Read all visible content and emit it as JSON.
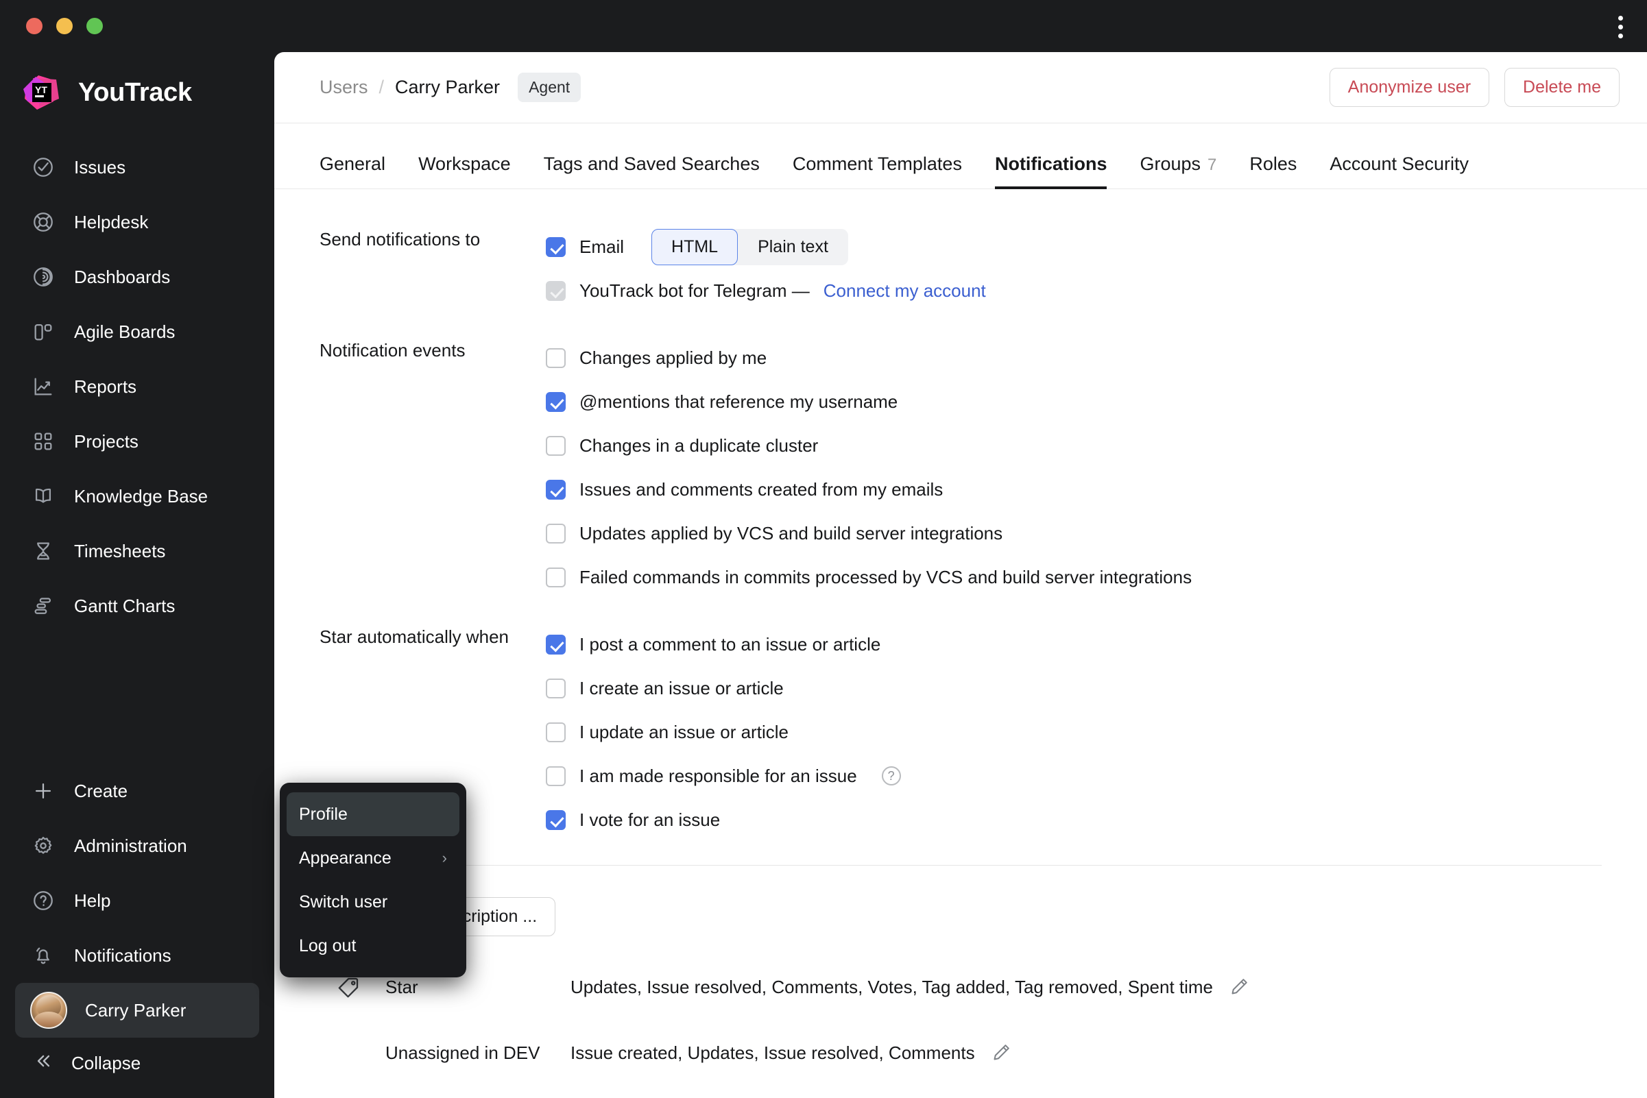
{
  "window": {
    "traffic_lights": [
      "close",
      "minimize",
      "zoom"
    ],
    "kebab_label": "more-options"
  },
  "brand": {
    "name": "YouTrack",
    "logo_text": "YT"
  },
  "sidebar": {
    "items": [
      {
        "label": "Issues",
        "icon": "check-circle-icon"
      },
      {
        "label": "Helpdesk",
        "icon": "lifebuoy-icon"
      },
      {
        "label": "Dashboards",
        "icon": "radar-icon"
      },
      {
        "label": "Agile Boards",
        "icon": "board-columns-icon"
      },
      {
        "label": "Reports",
        "icon": "chart-line-icon"
      },
      {
        "label": "Projects",
        "icon": "grid-squares-icon"
      },
      {
        "label": "Knowledge Base",
        "icon": "open-book-icon"
      },
      {
        "label": "Timesheets",
        "icon": "hourglass-icon"
      },
      {
        "label": "Gantt Charts",
        "icon": "gantt-bars-icon"
      }
    ],
    "bottom_items": [
      {
        "label": "Create",
        "icon": "plus-icon"
      },
      {
        "label": "Administration",
        "icon": "gear-icon"
      },
      {
        "label": "Help",
        "icon": "question-circle-icon"
      },
      {
        "label": "Notifications",
        "icon": "bell-icon"
      }
    ],
    "user": {
      "label": "Carry Parker",
      "icon": "avatar"
    },
    "collapse": {
      "label": "Collapse",
      "icon": "chevron-double-left-icon"
    }
  },
  "context_menu": {
    "items": [
      {
        "label": "Profile",
        "active": true,
        "submenu": false
      },
      {
        "label": "Appearance",
        "active": false,
        "submenu": true
      },
      {
        "label": "Switch user",
        "active": false,
        "submenu": false
      },
      {
        "label": "Log out",
        "active": false,
        "submenu": false
      }
    ],
    "submenu_arrow": "›"
  },
  "header": {
    "breadcrumb_parent": "Users",
    "breadcrumb_separator": "/",
    "breadcrumb_current": "Carry Parker",
    "badge": "Agent",
    "anonymize_label": "Anonymize user",
    "delete_label": "Delete me"
  },
  "tabs": [
    {
      "label": "General",
      "active": false
    },
    {
      "label": "Workspace",
      "active": false
    },
    {
      "label": "Tags and Saved Searches",
      "active": false
    },
    {
      "label": "Comment Templates",
      "active": false
    },
    {
      "label": "Notifications",
      "active": true
    },
    {
      "label": "Groups",
      "active": false,
      "count": "7"
    },
    {
      "label": "Roles",
      "active": false
    },
    {
      "label": "Account Security",
      "active": false
    }
  ],
  "send_notifications": {
    "label": "Send notifications to",
    "email": {
      "label": "Email",
      "checked": true
    },
    "format_options": [
      {
        "label": "HTML",
        "selected": true
      },
      {
        "label": "Plain text",
        "selected": false
      }
    ],
    "telegram": {
      "label": "YouTrack bot for Telegram —",
      "checked": true,
      "disabled": true,
      "link": "Connect my account"
    }
  },
  "notification_events": {
    "label": "Notification events",
    "items": [
      {
        "label": "Changes applied by me",
        "checked": false
      },
      {
        "label": "@mentions that reference my username",
        "checked": true
      },
      {
        "label": "Changes in a duplicate cluster",
        "checked": false
      },
      {
        "label": "Issues and comments created from my emails",
        "checked": true
      },
      {
        "label": "Updates applied by VCS and build server integrations",
        "checked": false
      },
      {
        "label": "Failed commands in commits processed by VCS and build server integrations",
        "checked": false
      }
    ]
  },
  "star_automatically": {
    "label": "Star automatically when",
    "items": [
      {
        "label": "I post a comment to an issue or article",
        "checked": true,
        "help": false
      },
      {
        "label": "I create an issue or article",
        "checked": false,
        "help": false
      },
      {
        "label": "I update an issue or article",
        "checked": false,
        "help": false
      },
      {
        "label": "I am made responsible for an issue",
        "checked": false,
        "help": true
      },
      {
        "label": "I vote for an issue",
        "checked": true,
        "help": false
      }
    ],
    "help_glyph": "?"
  },
  "subscriptions": {
    "new_button": "New subscription ...",
    "rows": [
      {
        "icon": "tag-icon",
        "name": "Star",
        "events": "Updates, Issue resolved, Comments, Votes, Tag added, Tag removed, Spent time",
        "edit_icon": "pencil-icon"
      },
      {
        "icon": "none",
        "name": "Unassigned in DEV",
        "events": "Issue created, Updates, Issue resolved, Comments",
        "edit_icon": "pencil-icon"
      }
    ]
  },
  "colors": {
    "accent_blue": "#4a77e8",
    "link_blue": "#3b5fd0",
    "danger_red": "#c84a55",
    "sidebar_bg": "#1b1c1e",
    "main_bg": "#ffffff"
  }
}
